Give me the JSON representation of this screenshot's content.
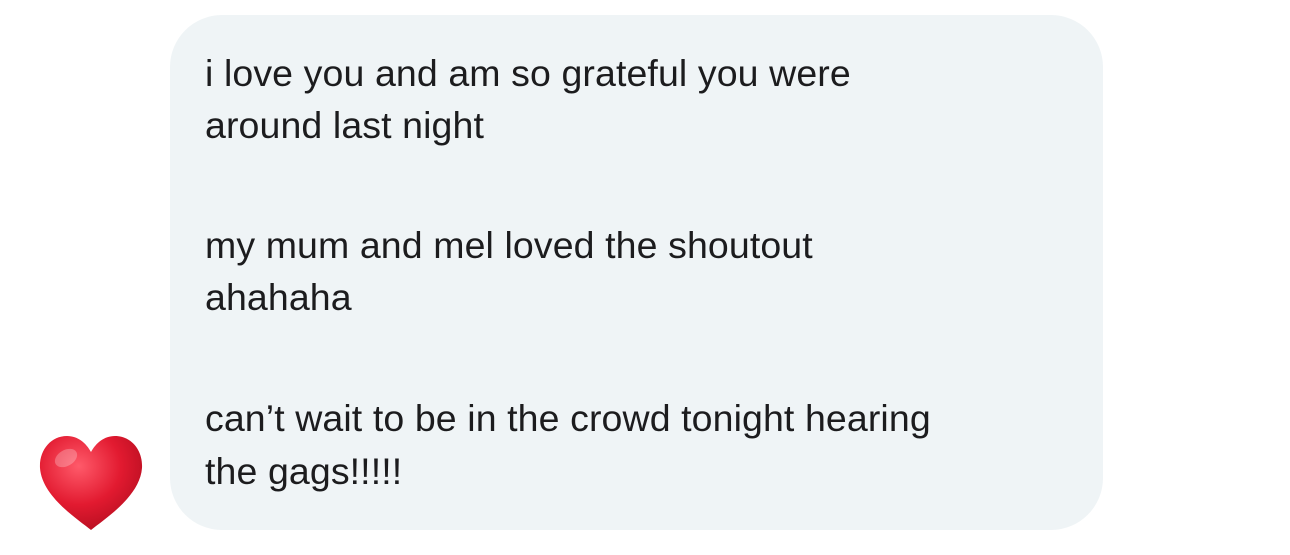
{
  "message": {
    "lines": [
      "i love you and am so grateful you were",
      "around last night",
      "my mum and mel loved the shoutout",
      "ahahaha",
      "can’t wait to be in the crowd tonight hearing",
      "the gags!!!!!"
    ]
  },
  "reaction": {
    "icon": "red-heart-icon",
    "color": "#e0182d"
  },
  "colors": {
    "bubble": "#eff4f6",
    "text": "#1c1c1e",
    "background": "#ffffff"
  }
}
